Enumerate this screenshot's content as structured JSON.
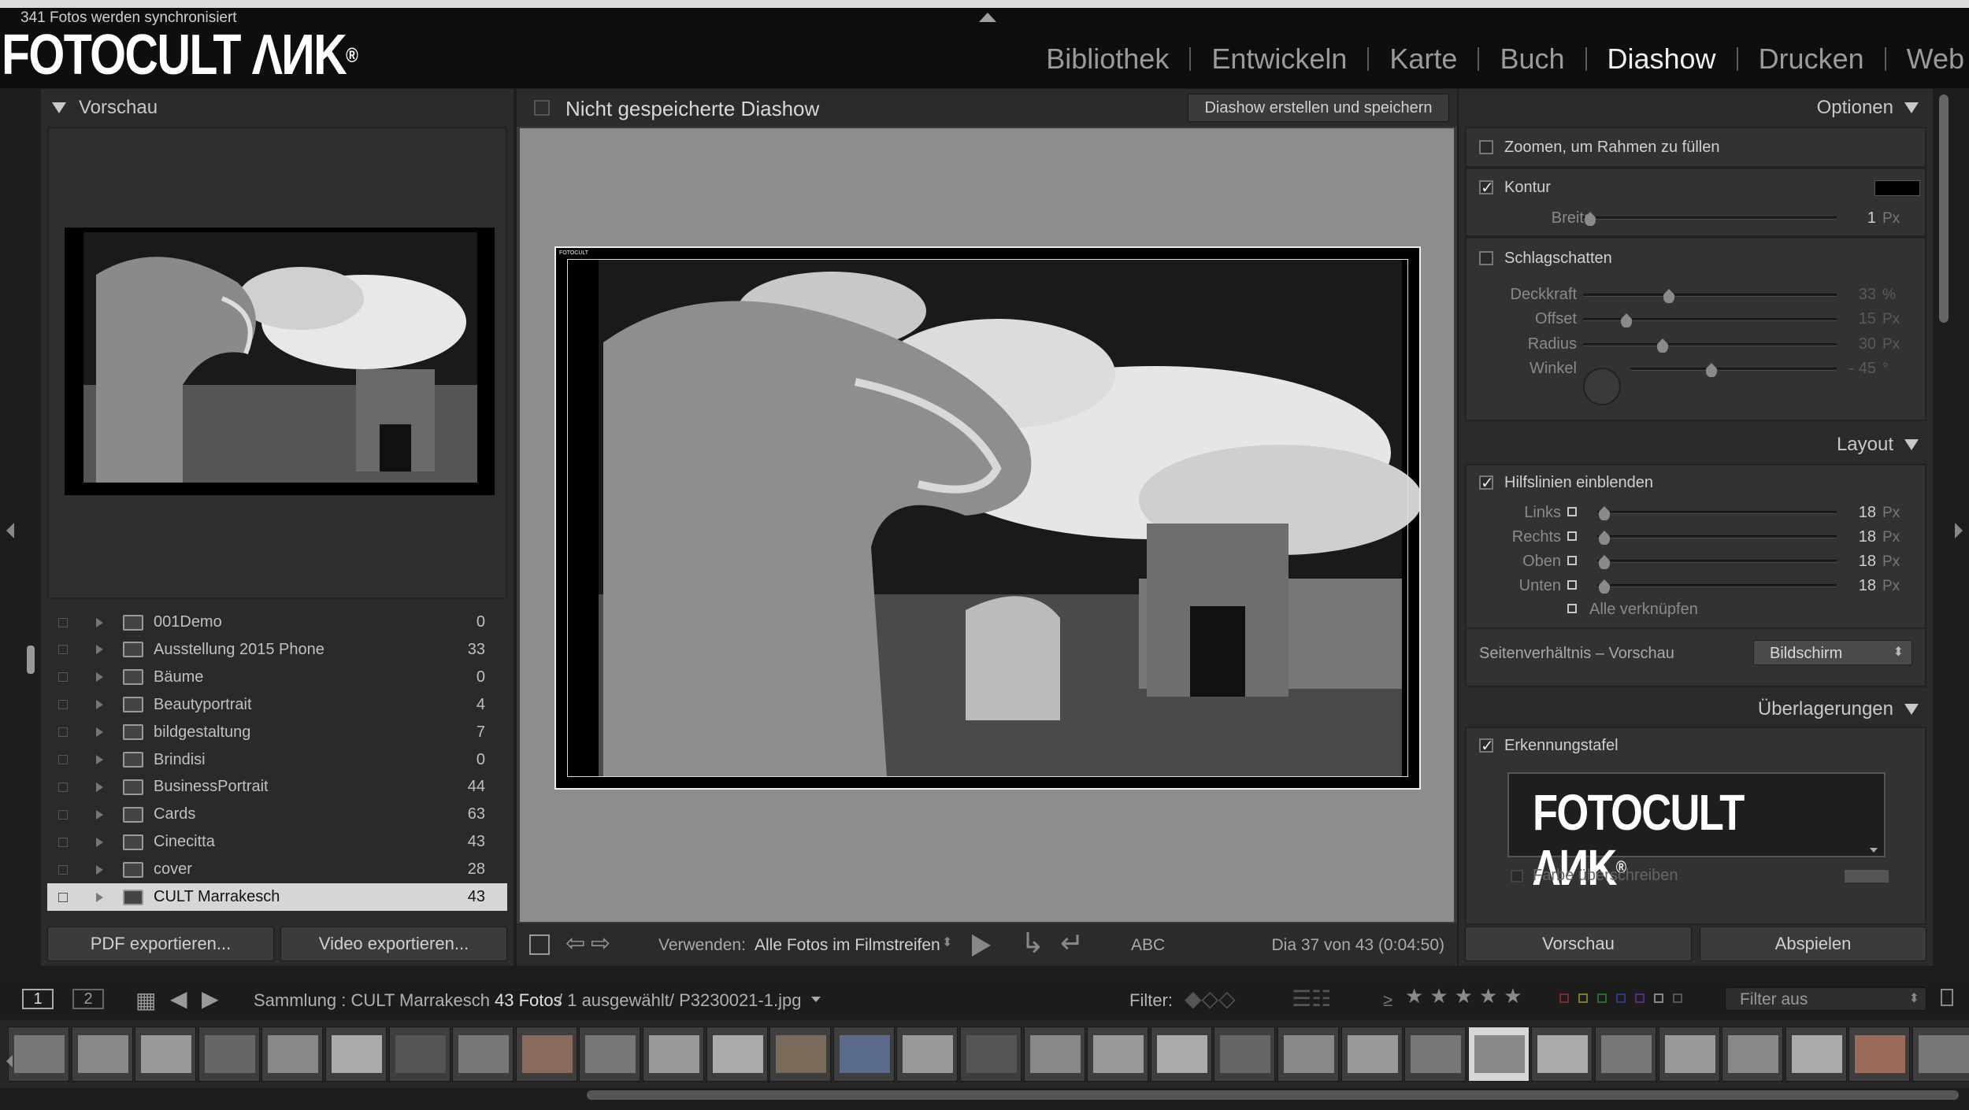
{
  "app": {
    "sync_status": "341 Fotos werden synchronisiert",
    "logo_text": "FOTOCULT ΛИK",
    "logo_reg": "®",
    "modules": [
      "Bibliothek",
      "Entwickeln",
      "Karte",
      "Buch",
      "Diashow",
      "Drucken",
      "Web"
    ],
    "active_module": "Diashow"
  },
  "left": {
    "preview_header": "Vorschau",
    "collections": [
      {
        "name": "001Demo",
        "count": "0"
      },
      {
        "name": "Ausstellung 2015 Phone",
        "count": "33"
      },
      {
        "name": "Bäume",
        "count": "0"
      },
      {
        "name": "Beautyportrait",
        "count": "4"
      },
      {
        "name": "bildgestaltung",
        "count": "7"
      },
      {
        "name": "Brindisi",
        "count": "0"
      },
      {
        "name": "BusinessPortrait",
        "count": "44"
      },
      {
        "name": "Cards",
        "count": "63"
      },
      {
        "name": "Cinecitta",
        "count": "43"
      },
      {
        "name": "cover",
        "count": "28"
      },
      {
        "name": "CULT Marrakesch",
        "count": "43"
      }
    ],
    "selected_collection_index": 10,
    "pdf_button": "PDF exportieren...",
    "video_button": "Video exportieren..."
  },
  "center": {
    "title": "Nicht gespeicherte Diashow",
    "save_button": "Diashow erstellen und speichern",
    "use_label": "Verwenden:",
    "use_value": "Alle Fotos im Filmstreifen",
    "abc_label": "ABC",
    "status": "Dia 37 von 43 (0:04:50)"
  },
  "right": {
    "options_header": "Optionen",
    "zoom_fill": "Zoomen, um Rahmen zu füllen",
    "zoom_fill_checked": false,
    "kontur": "Kontur",
    "kontur_checked": true,
    "kontur_color": "#000000",
    "breite_label": "Breite",
    "breite_value": "1",
    "px": "Px",
    "percent": "%",
    "degree": "°",
    "schatten": "Schlagschatten",
    "schatten_checked": false,
    "deckkraft_label": "Deckkraft",
    "deckkraft_value": "33",
    "offset_label": "Offset",
    "offset_value": "15",
    "radius_label": "Radius",
    "radius_value": "30",
    "winkel_label": "Winkel",
    "winkel_value": "- 45",
    "layout_header": "Layout",
    "hilfslinien": "Hilfslinien einblenden",
    "hilfslinien_checked": true,
    "links_label": "Links",
    "links_value": "18",
    "rechts_label": "Rechts",
    "rechts_value": "18",
    "oben_label": "Oben",
    "oben_value": "18",
    "unten_label": "Unten",
    "unten_value": "18",
    "alle_verknuepfen": "Alle verknüpfen",
    "aspect_label": "Seitenverhältnis – Vorschau",
    "aspect_value": "Bildschirm",
    "overlays_header": "Überlagerungen",
    "erkennungstafel": "Erkennungstafel",
    "erkennungstafel_checked": true,
    "farbe": "Farbe überschreiben",
    "vorschau_button": "Vorschau",
    "abspielen_button": "Abspielen"
  },
  "filterbar": {
    "view1": "1",
    "view2": "2",
    "sammlung_label": "Sammlung : CULT Marrakesch",
    "fotos_count": "43 Fotos",
    "selection": "/ 1 ausgewählt/ P3230021-1.jpg",
    "filter_label": "Filter:",
    "filter_value": "Filter aus",
    "rating_operator": "≥"
  }
}
